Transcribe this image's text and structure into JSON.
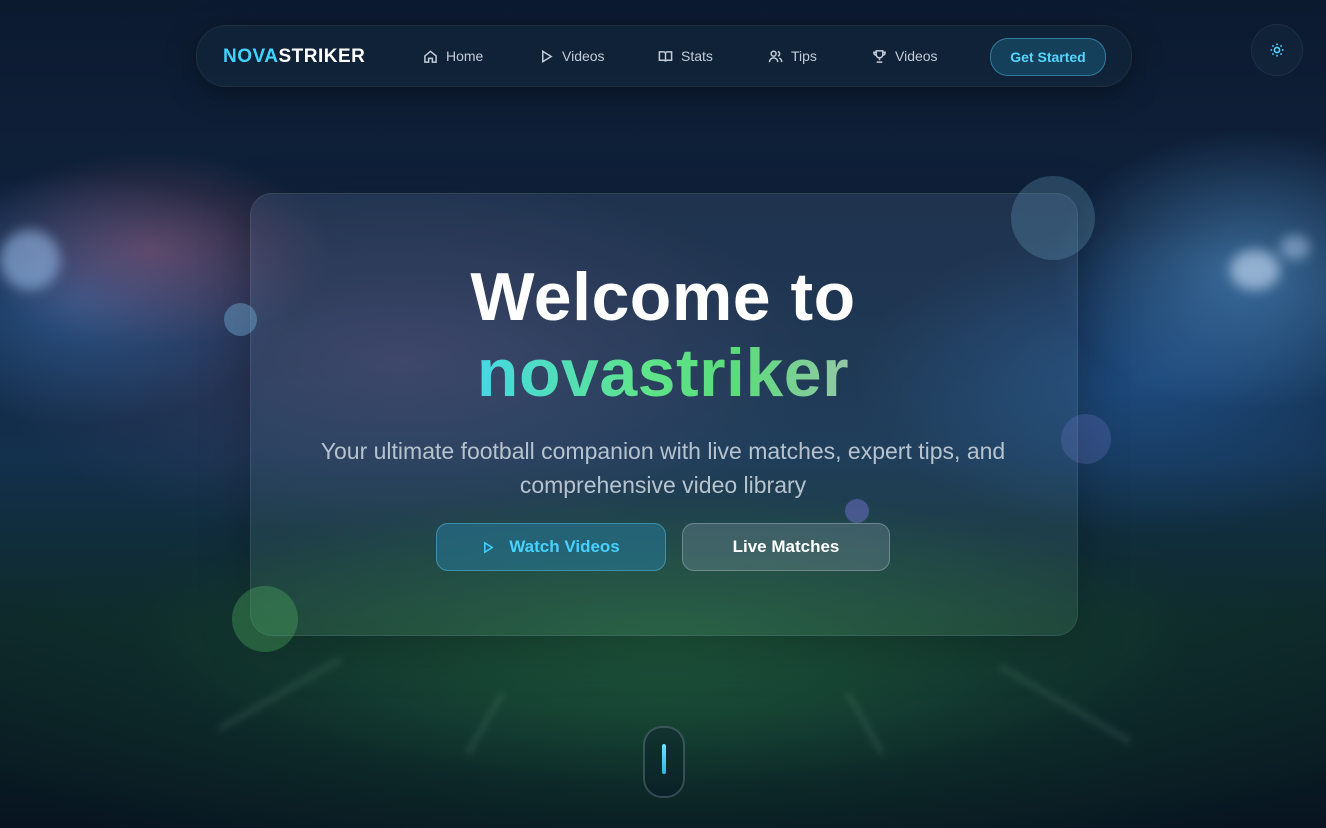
{
  "brand": {
    "logo_part1": "NOVA",
    "logo_part2": "STRIKER"
  },
  "nav": {
    "items": [
      {
        "label": "Home",
        "icon": "home-icon"
      },
      {
        "label": "Videos",
        "icon": "play-icon"
      },
      {
        "label": "Stats",
        "icon": "book-icon"
      },
      {
        "label": "Tips",
        "icon": "users-icon"
      },
      {
        "label": "Videos",
        "icon": "trophy-icon"
      }
    ],
    "cta_label": "Get Started"
  },
  "theme_toggle": {
    "icon": "sun-icon"
  },
  "hero": {
    "title_line1": "Welcome to",
    "title_line2": "novastriker",
    "subtitle": "Your ultimate football companion with live matches, expert tips, and comprehensive video library",
    "primary_button": {
      "label": "Watch Videos",
      "icon": "play-icon"
    },
    "secondary_button": {
      "label": "Live Matches"
    }
  },
  "scroll_indicator": {
    "icon": "scroll-mouse-icon"
  },
  "colors": {
    "accent_cyan": "#3fd4ff",
    "accent_green": "#5fe48a",
    "background": "#0b1a2e"
  }
}
